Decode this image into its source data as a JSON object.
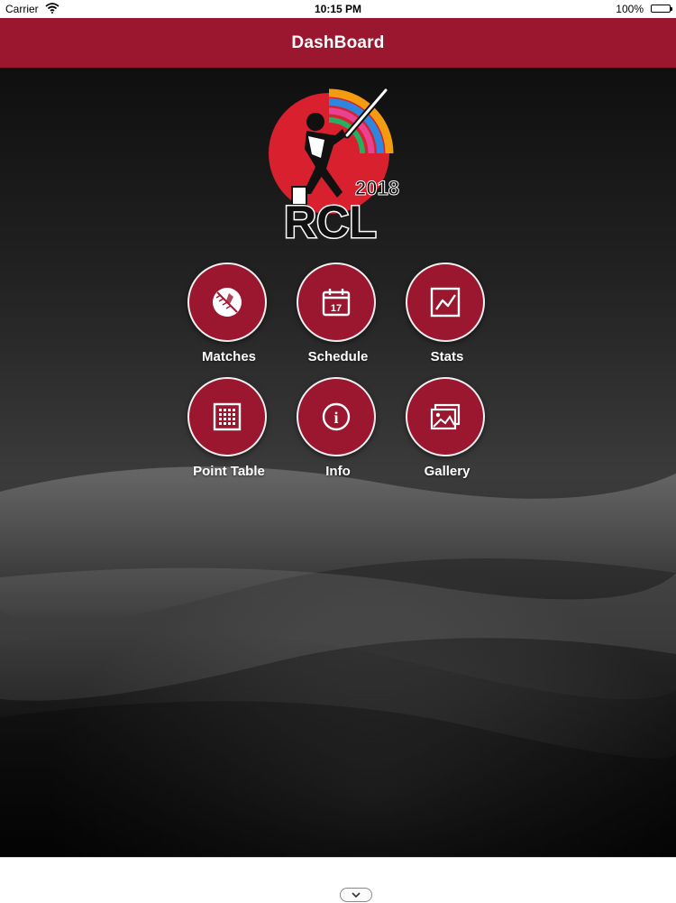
{
  "status_bar": {
    "carrier": "Carrier",
    "time": "10:15 PM",
    "battery": "100%"
  },
  "nav": {
    "title": "DashBoard"
  },
  "logo": {
    "year": "2018",
    "wordmark": "RCL"
  },
  "menu": [
    {
      "label": "Matches",
      "icon": "cricket-ball-icon"
    },
    {
      "label": "Schedule",
      "icon": "calendar-icon",
      "icon_text": "17"
    },
    {
      "label": "Stats",
      "icon": "line-chart-icon"
    },
    {
      "label": "Point Table",
      "icon": "grid-table-icon"
    },
    {
      "label": "Info",
      "icon": "info-icon",
      "icon_text": "i"
    },
    {
      "label": "Gallery",
      "icon": "gallery-icon"
    }
  ],
  "colors": {
    "brand": "#9b1730",
    "background_dark": "#1c1c1c"
  }
}
